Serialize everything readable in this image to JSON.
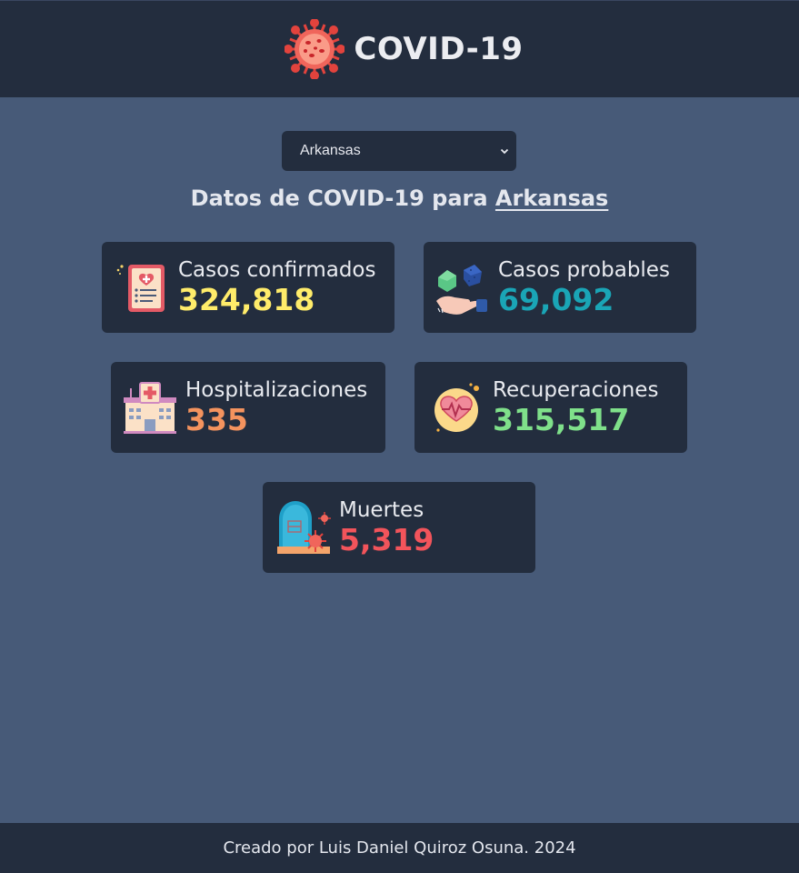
{
  "header": {
    "title": "COVID-19",
    "logo_icon": "virus-icon"
  },
  "state_select": {
    "selected": "Arkansas"
  },
  "heading": {
    "prefix": "Datos de COVID-19 para",
    "state": "Arkansas"
  },
  "stats": [
    {
      "label": "Casos confirmados",
      "value": "324,818",
      "color": "#ffec6a",
      "icon": "clipboard-health-icon"
    },
    {
      "label": "Casos probables",
      "value": "69,092",
      "color": "#1aa5b6",
      "icon": "dice-hand-icon"
    },
    {
      "label": "Hospitalizaciones",
      "value": "335",
      "color": "#f4935e",
      "icon": "hospital-icon"
    },
    {
      "label": "Recuperaciones",
      "value": "315,517",
      "color": "#7fe08a",
      "icon": "heart-pulse-icon"
    },
    {
      "label": "Muertes",
      "value": "5,319",
      "color": "#f2545b",
      "icon": "tombstone-virus-icon"
    }
  ],
  "footer": {
    "text": "Creado por Luis Daniel Quiroz Osuna. 2024"
  }
}
